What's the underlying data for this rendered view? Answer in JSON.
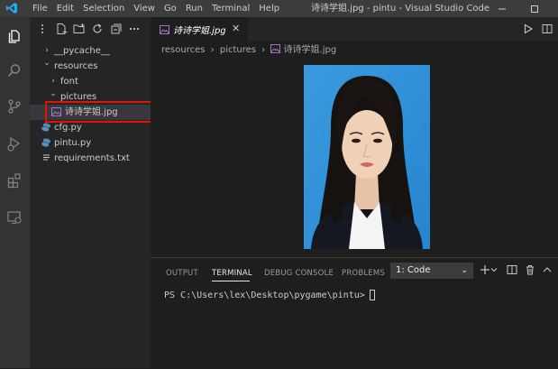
{
  "menu": [
    "File",
    "Edit",
    "Selection",
    "View",
    "Go",
    "Run",
    "Terminal",
    "Help"
  ],
  "window_title": "诗诗学姐.jpg - pintu - Visual Studio Code",
  "explorer": {
    "items": [
      {
        "label": "__pycache__",
        "chevron": "›"
      },
      {
        "label": "resources",
        "chevron": "⌄"
      },
      {
        "label": "font",
        "chevron": "›"
      },
      {
        "label": "pictures",
        "chevron": "⌄"
      },
      {
        "label": "诗诗学姐.jpg"
      },
      {
        "label": "cfg.py"
      },
      {
        "label": "pintu.py"
      },
      {
        "label": "requirements.txt"
      }
    ]
  },
  "editor": {
    "tab_label": "诗诗学姐.jpg",
    "breadcrumb": [
      "resources",
      "pictures",
      "诗诗学姐.jpg"
    ]
  },
  "panel": {
    "tabs": [
      "OUTPUT",
      "TERMINAL",
      "DEBUG CONSOLE",
      "PROBLEMS"
    ],
    "active_tab": "TERMINAL",
    "terminal_select": "1: Code",
    "prompt": "PS C:\\Users\\lex\\Desktop\\pygame\\pintu>"
  },
  "colors": {
    "accent_blue": "#007acc",
    "highlight_red": "#e51400",
    "photo_background": "#2f93d8"
  }
}
